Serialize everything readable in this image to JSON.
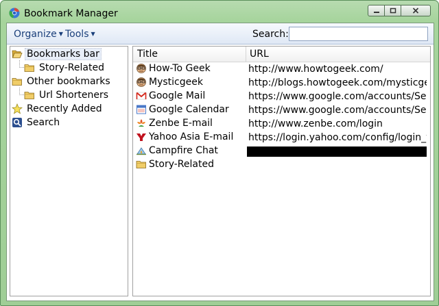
{
  "window": {
    "title": "Bookmark Manager"
  },
  "toolbar": {
    "organize_label": "Organize",
    "tools_label": "Tools",
    "search_label": "Search:",
    "search_value": ""
  },
  "tree": {
    "items": [
      {
        "label": "Bookmarks bar",
        "icon": "folder-open-icon",
        "selected": true
      },
      {
        "label": "Story-Related",
        "icon": "folder-icon"
      },
      {
        "label": "Other bookmarks",
        "icon": "folder-icon"
      },
      {
        "label": "Url Shorteners",
        "icon": "folder-icon"
      },
      {
        "label": "Recently Added",
        "icon": "star-icon"
      },
      {
        "label": "Search",
        "icon": "search-icon"
      }
    ]
  },
  "list": {
    "columns": [
      "Title",
      "URL"
    ],
    "rows": [
      {
        "title": "How-To Geek",
        "url": "http://www.howtogeek.com/",
        "icon": "geek-favicon-icon"
      },
      {
        "title": "Mysticgeek",
        "url": "http://blogs.howtogeek.com/mysticgeek/",
        "icon": "geek-favicon-icon"
      },
      {
        "title": "Google Mail",
        "url": "https://www.google.com/accounts/Ser...",
        "icon": "gmail-icon"
      },
      {
        "title": "Google Calendar",
        "url": "https://www.google.com/accounts/Ser...",
        "icon": "calendar-icon"
      },
      {
        "title": "Zenbe E-mail",
        "url": "http://www.zenbe.com/login",
        "icon": "zenbe-icon"
      },
      {
        "title": "Yahoo Asia E-mail",
        "url": "https://login.yahoo.com/config/login_v...",
        "icon": "yahoo-icon"
      },
      {
        "title": "Campfire Chat",
        "url": "",
        "icon": "campfire-icon",
        "redacted": true
      },
      {
        "title": "Story-Related",
        "url": "",
        "icon": "folder-icon"
      }
    ]
  },
  "colors": {
    "frame": "#a6d49c",
    "menu_text": "#1a3f7a",
    "folder": "#e8c25a",
    "redaction": "#000000"
  }
}
